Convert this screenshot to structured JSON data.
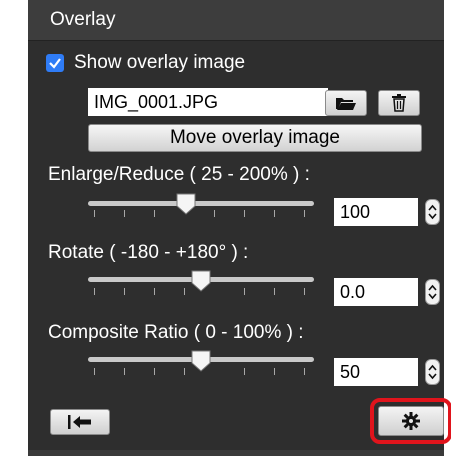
{
  "panel": {
    "title": "Overlay"
  },
  "show_overlay": {
    "label": "Show overlay image",
    "checked": true,
    "accent_color": "#2f7cf6"
  },
  "file": {
    "name": "IMG_0001.JPG",
    "open_icon": "folder-open-icon",
    "delete_icon": "trash-icon"
  },
  "move_button": {
    "label": "Move overlay image"
  },
  "enlarge": {
    "label": "Enlarge/Reduce ( 25 - 200% ) :",
    "value": "100",
    "slider_min": 25,
    "slider_max": 200,
    "slider_value": 100
  },
  "rotate": {
    "label": "Rotate ( -180 - +180° ) :",
    "value": "0.0",
    "slider_min": -180,
    "slider_max": 180,
    "slider_value": 0
  },
  "composite": {
    "label": "Composite Ratio ( 0 - 100% ) :",
    "value": "50",
    "slider_min": 0,
    "slider_max": 100,
    "slider_value": 50
  },
  "footer": {
    "reset_icon": "reset-arrow-icon",
    "settings_icon": "gear-icon",
    "highlight_color": "#e0141c"
  }
}
